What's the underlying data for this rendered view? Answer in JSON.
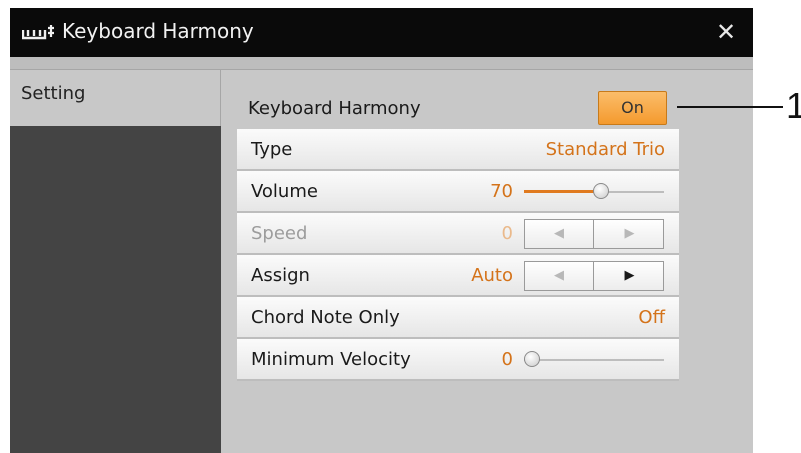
{
  "window": {
    "title": "Keyboard Harmony",
    "close_symbol": "✕",
    "app_icon": "keyboard-harmony-icon",
    "close_icon": "close-icon"
  },
  "sidebar": {
    "tabs": [
      {
        "label": "Setting",
        "selected": true
      }
    ]
  },
  "main": {
    "keyboard_harmony": {
      "label": "Keyboard Harmony",
      "button_label": "On",
      "button_color": "#f5a33a"
    },
    "rows": [
      {
        "label": "Type",
        "value": "Standard Trio"
      },
      {
        "label": "Volume",
        "value": "70",
        "slider_level_percent": 55
      },
      {
        "label": "Speed",
        "value": "0",
        "enabled": false,
        "left_arrow": "◀",
        "right_arrow": "▶"
      },
      {
        "label": "Assign",
        "value": "Auto",
        "left_arrow": "◀",
        "right_arrow": "▶"
      },
      {
        "label": "Chord Note Only",
        "value": "Off"
      },
      {
        "label": "Minimum Velocity",
        "value": "0",
        "slider_level_percent": 0
      }
    ]
  },
  "annotation": {
    "callout_number": "1"
  },
  "colors": {
    "accent": "#d4731a",
    "title_bar": "#0a0a0a",
    "sidebar_dark": "#444444"
  }
}
